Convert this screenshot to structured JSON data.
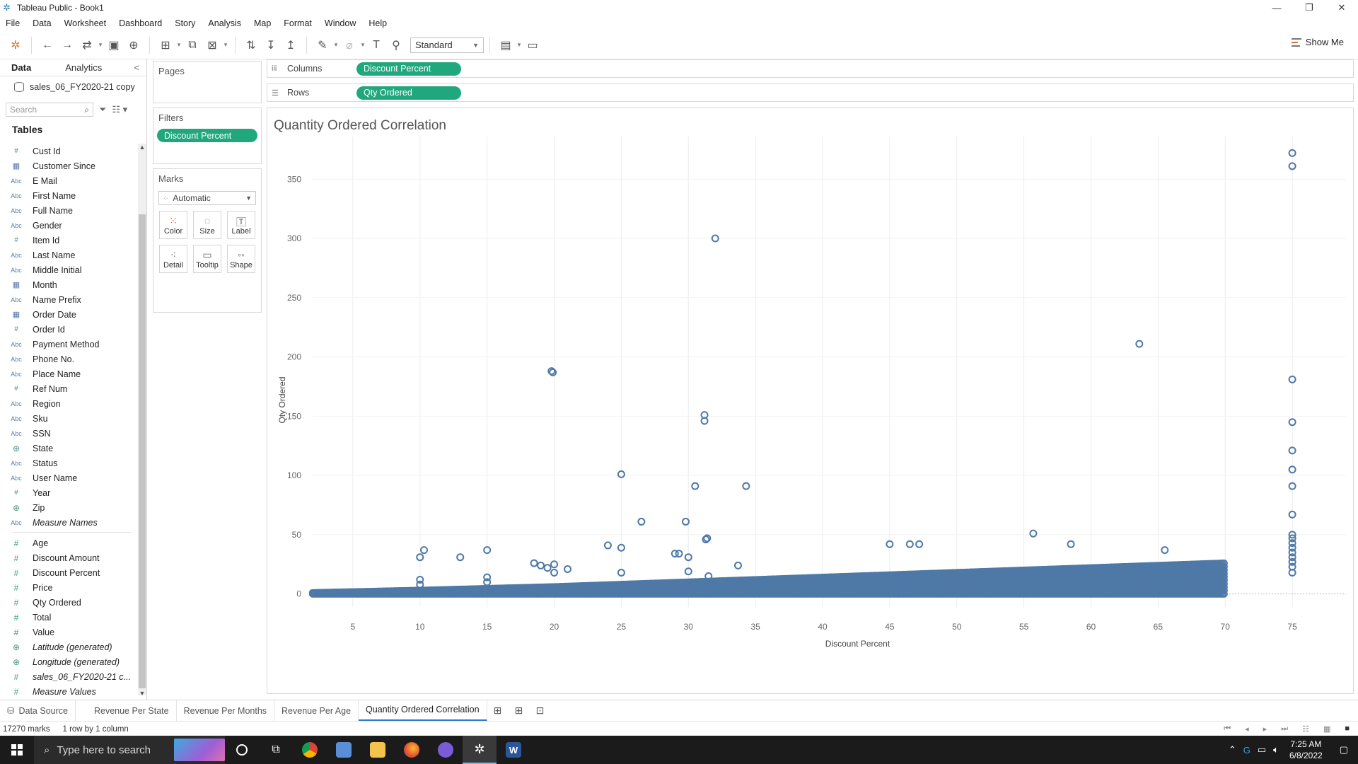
{
  "window": {
    "title": "Tableau Public - Book1"
  },
  "menu": [
    "File",
    "Data",
    "Worksheet",
    "Dashboard",
    "Story",
    "Analysis",
    "Map",
    "Format",
    "Window",
    "Help"
  ],
  "toolbar": {
    "fit": "Standard",
    "show_me": "Show Me"
  },
  "data_pane": {
    "tab_data": "Data",
    "tab_analytics": "Analytics",
    "source": "sales_06_FY2020-21 copy",
    "search_placeholder": "Search",
    "tables_heading": "Tables",
    "dimensions": [
      {
        "type": "num",
        "name": "Cust Id"
      },
      {
        "type": "cal",
        "name": "Customer Since"
      },
      {
        "type": "abc",
        "name": "E Mail"
      },
      {
        "type": "abc",
        "name": "First Name"
      },
      {
        "type": "abc",
        "name": "Full Name"
      },
      {
        "type": "abc",
        "name": "Gender"
      },
      {
        "type": "num",
        "name": "Item Id"
      },
      {
        "type": "abc",
        "name": "Last Name"
      },
      {
        "type": "abc",
        "name": "Middle Initial"
      },
      {
        "type": "cal",
        "name": "Month"
      },
      {
        "type": "abc",
        "name": "Name Prefix"
      },
      {
        "type": "cal",
        "name": "Order Date"
      },
      {
        "type": "num",
        "name": "Order Id"
      },
      {
        "type": "abc",
        "name": "Payment Method"
      },
      {
        "type": "abc",
        "name": "Phone No."
      },
      {
        "type": "abc",
        "name": "Place Name"
      },
      {
        "type": "num",
        "name": "Ref Num"
      },
      {
        "type": "abc",
        "name": "Region"
      },
      {
        "type": "abc",
        "name": "Sku"
      },
      {
        "type": "abc",
        "name": "SSN"
      },
      {
        "type": "geo",
        "name": "State"
      },
      {
        "type": "abc",
        "name": "Status"
      },
      {
        "type": "abc",
        "name": "User Name"
      },
      {
        "type": "num",
        "name": "Year"
      },
      {
        "type": "geo",
        "name": "Zip"
      },
      {
        "type": "abc",
        "name": "Measure Names",
        "italic": true
      }
    ],
    "measures": [
      {
        "type": "meas",
        "name": "Age"
      },
      {
        "type": "meas",
        "name": "Discount Amount"
      },
      {
        "type": "meas",
        "name": "Discount Percent"
      },
      {
        "type": "meas",
        "name": "Price"
      },
      {
        "type": "meas",
        "name": "Qty Ordered"
      },
      {
        "type": "meas",
        "name": "Total"
      },
      {
        "type": "meas",
        "name": "Value"
      },
      {
        "type": "geo",
        "name": "Latitude (generated)",
        "italic": true
      },
      {
        "type": "geo",
        "name": "Longitude (generated)",
        "italic": true
      },
      {
        "type": "meas",
        "name": "sales_06_FY2020-21 c...",
        "italic": true
      },
      {
        "type": "meas",
        "name": "Measure Values",
        "italic": true
      }
    ]
  },
  "pages": {
    "title": "Pages"
  },
  "filters": {
    "title": "Filters",
    "items": [
      "Discount Percent"
    ]
  },
  "marks": {
    "title": "Marks",
    "type": "Automatic",
    "buttons": [
      "Color",
      "Size",
      "Label",
      "Detail",
      "Tooltip",
      "Shape"
    ]
  },
  "shelves": {
    "columns_label": "Columns",
    "columns_pill": "Discount Percent",
    "rows_label": "Rows",
    "rows_pill": "Qty Ordered"
  },
  "chart_data": {
    "type": "scatter",
    "title": "Quantity Ordered Correlation",
    "xlabel": "Discount Percent",
    "ylabel": "Qty Ordered",
    "xlim": [
      2,
      79
    ],
    "ylim": [
      -5,
      380
    ],
    "xticks": [
      5,
      10,
      15,
      20,
      25,
      30,
      35,
      40,
      45,
      50,
      55,
      60,
      65,
      70,
      75
    ],
    "yticks": [
      0,
      50,
      100,
      150,
      200,
      250,
      300,
      350
    ],
    "grid": true,
    "marker": "open-circle",
    "color": "#4e79a7",
    "points": [
      [
        10,
        31
      ],
      [
        10.3,
        37
      ],
      [
        13,
        31
      ],
      [
        15,
        37
      ],
      [
        15,
        14
      ],
      [
        15,
        10
      ],
      [
        10,
        12
      ],
      [
        10,
        8
      ],
      [
        18.5,
        26
      ],
      [
        19,
        24
      ],
      [
        19.5,
        22
      ],
      [
        19.8,
        188
      ],
      [
        19.9,
        187
      ],
      [
        20,
        25
      ],
      [
        20,
        18
      ],
      [
        21,
        21
      ],
      [
        24,
        41
      ],
      [
        25,
        39
      ],
      [
        25,
        101
      ],
      [
        25,
        18
      ],
      [
        26.5,
        61
      ],
      [
        29,
        34
      ],
      [
        29.3,
        34
      ],
      [
        29.8,
        61
      ],
      [
        30,
        31
      ],
      [
        30,
        19
      ],
      [
        30.5,
        91
      ],
      [
        31.2,
        151
      ],
      [
        31.2,
        146
      ],
      [
        31.3,
        46
      ],
      [
        31.4,
        47
      ],
      [
        31.5,
        15
      ],
      [
        32,
        300
      ],
      [
        33.7,
        24
      ],
      [
        34.3,
        91
      ],
      [
        45,
        42
      ],
      [
        46.5,
        42
      ],
      [
        47.2,
        42
      ],
      [
        55.7,
        51
      ],
      [
        58.5,
        42
      ],
      [
        63.6,
        211
      ],
      [
        65.5,
        37
      ],
      [
        75,
        372
      ],
      [
        75,
        361
      ],
      [
        75,
        181
      ],
      [
        75,
        145
      ],
      [
        75,
        121
      ],
      [
        75,
        105
      ],
      [
        75,
        91
      ],
      [
        75,
        67
      ],
      [
        75,
        50
      ],
      [
        75,
        47
      ],
      [
        75,
        43
      ],
      [
        75,
        39
      ],
      [
        75,
        35
      ],
      [
        75,
        31
      ],
      [
        75,
        27
      ],
      [
        75,
        23
      ],
      [
        75,
        18
      ]
    ],
    "band": {
      "description": "dense cloud of low-quantity points along the x-axis",
      "x_range": [
        2,
        70
      ],
      "y_min": 0,
      "y_levels_by_x": [
        [
          2,
          1
        ],
        [
          10,
          3
        ],
        [
          20,
          6
        ],
        [
          30,
          10
        ],
        [
          40,
          14
        ],
        [
          50,
          18
        ],
        [
          60,
          22
        ],
        [
          70,
          26
        ]
      ]
    }
  },
  "sheets": {
    "data_source": "Data Source",
    "tabs": [
      "Revenue Per State",
      "Revenue Per Months",
      "Revenue Per Age",
      "Quantity Ordered Correlation"
    ],
    "active": 3
  },
  "status": {
    "marks": "17270 marks",
    "shape": "1 row by 1 column"
  },
  "taskbar": {
    "search_placeholder": "Type here to search",
    "time": "7:25 AM",
    "date": "6/8/2022"
  }
}
